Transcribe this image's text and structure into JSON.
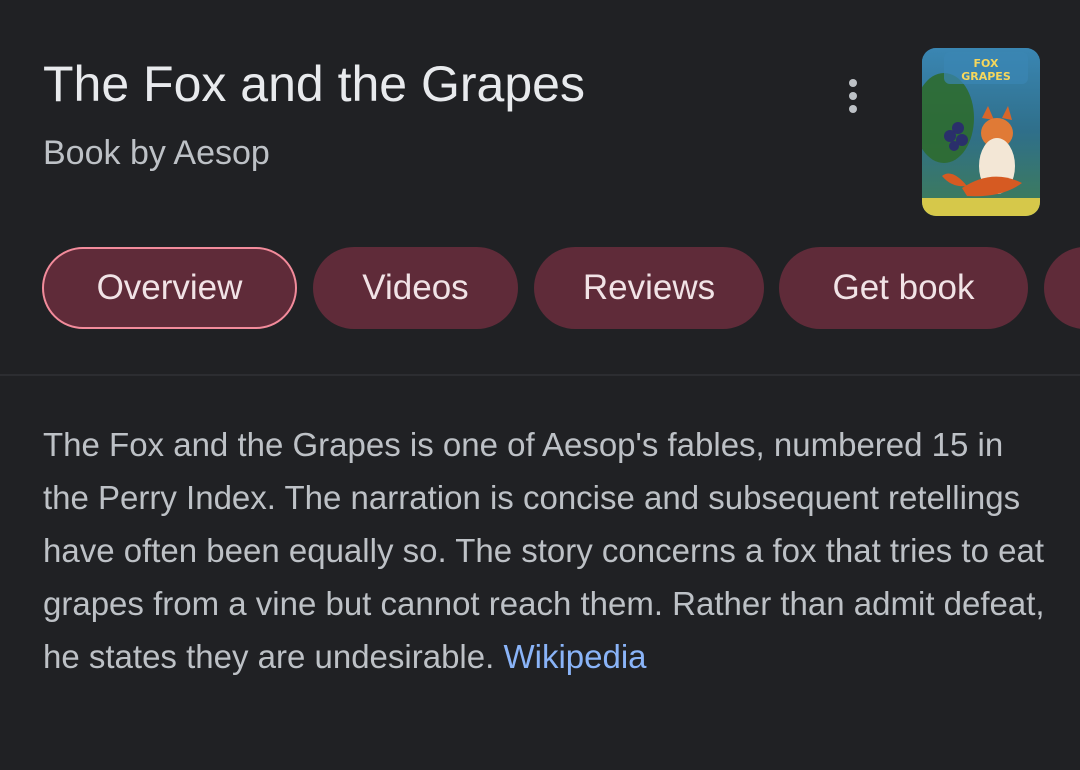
{
  "header": {
    "title": "The Fox and the Grapes",
    "subtitle": "Book by Aesop",
    "more_icon": "more-vert-icon",
    "thumbnail_text": "Fox Grapes"
  },
  "tabs": [
    {
      "label": "Overview",
      "active": true
    },
    {
      "label": "Videos",
      "active": false
    },
    {
      "label": "Reviews",
      "active": false
    },
    {
      "label": "Get book",
      "active": false
    }
  ],
  "description": {
    "text": "The Fox and the Grapes is one of Aesop's fables, numbered 15 in the Perry Index. The narration is concise and subsequent retellings have often been equally so. The story concerns a fox that tries to eat grapes from a vine but cannot reach them. Rather than admit defeat, he states they are undesirable.",
    "source_link": "Wikipedia"
  },
  "colors": {
    "background": "#202124",
    "tab_background": "#5f2b39",
    "tab_active_border": "#f28b9b",
    "link": "#8ab4f8"
  }
}
